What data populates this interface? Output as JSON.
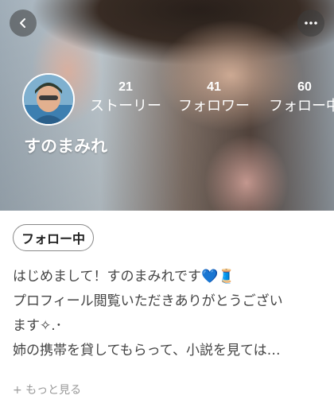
{
  "colors": {
    "accent_heart": "#2a73c7",
    "header_button_bg": "rgba(60,60,60,0.55)",
    "text_primary": "#444444",
    "text_muted": "#999999"
  },
  "header": {
    "back_icon": "chevron-left-icon",
    "more_icon": "more-horizontal-icon"
  },
  "profile": {
    "username": "すのまみれ",
    "avatar_icon": "avatar-photo",
    "stats": [
      {
        "count": "21",
        "label": "ストーリー"
      },
      {
        "count": "41",
        "label": "フォロワー"
      },
      {
        "count": "60",
        "label": "フォロー中"
      }
    ],
    "follow_button": "フォロー中"
  },
  "bio": {
    "line1": "はじめまして！すのまみれです",
    "line1_emoji": "💙🧵",
    "line2": "プロフィール閲覧いただきありがとうござい",
    "line3": "ます✧.･",
    "line4": "姉の携帯を貸してもらって、小説を見ては…",
    "more_link": "+ もっと見る"
  }
}
